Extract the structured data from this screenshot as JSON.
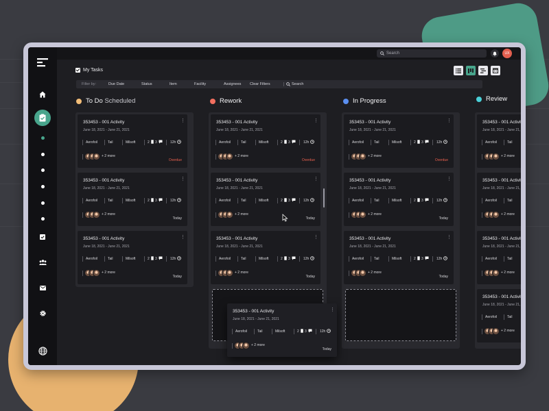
{
  "search": {
    "placeholder": "Search"
  },
  "user": {
    "initials": "UX"
  },
  "board": {
    "title": "My Tasks"
  },
  "views": [
    "list-view-icon",
    "board-view-icon",
    "timeline-view-icon",
    "calendar-view-icon"
  ],
  "filters": {
    "label": "Filter by:",
    "items": [
      "Due Date",
      "Status",
      "Item",
      "Facility",
      "Assignees"
    ],
    "clear": "Clear Filters",
    "search_placeholder": "Search"
  },
  "columns": [
    {
      "name": "To Do",
      "subtitle": "Scheduled",
      "color": "#f2bd78"
    },
    {
      "name": "Rework",
      "subtitle": "",
      "color": "#f26f5f"
    },
    {
      "name": "In Progress",
      "subtitle": "",
      "color": "#5b8ff0"
    },
    {
      "name": "Review",
      "subtitle": "",
      "color": "#4ad0d8"
    }
  ],
  "card": {
    "title": "353453 - 001 Activity",
    "date": "June 18, 2021 - June 21, 2021",
    "tags": [
      "Aerofoil",
      "Tail",
      "Milsoft"
    ],
    "count_a": "2",
    "count_b": "3",
    "hours": "12h",
    "more": "+ 2 more"
  },
  "statuses": {
    "overdue": "Overdue",
    "today": "Today"
  },
  "colors": {
    "overdue": "#e8604e",
    "today": "#d6d6da",
    "accent": "#48a58c"
  }
}
